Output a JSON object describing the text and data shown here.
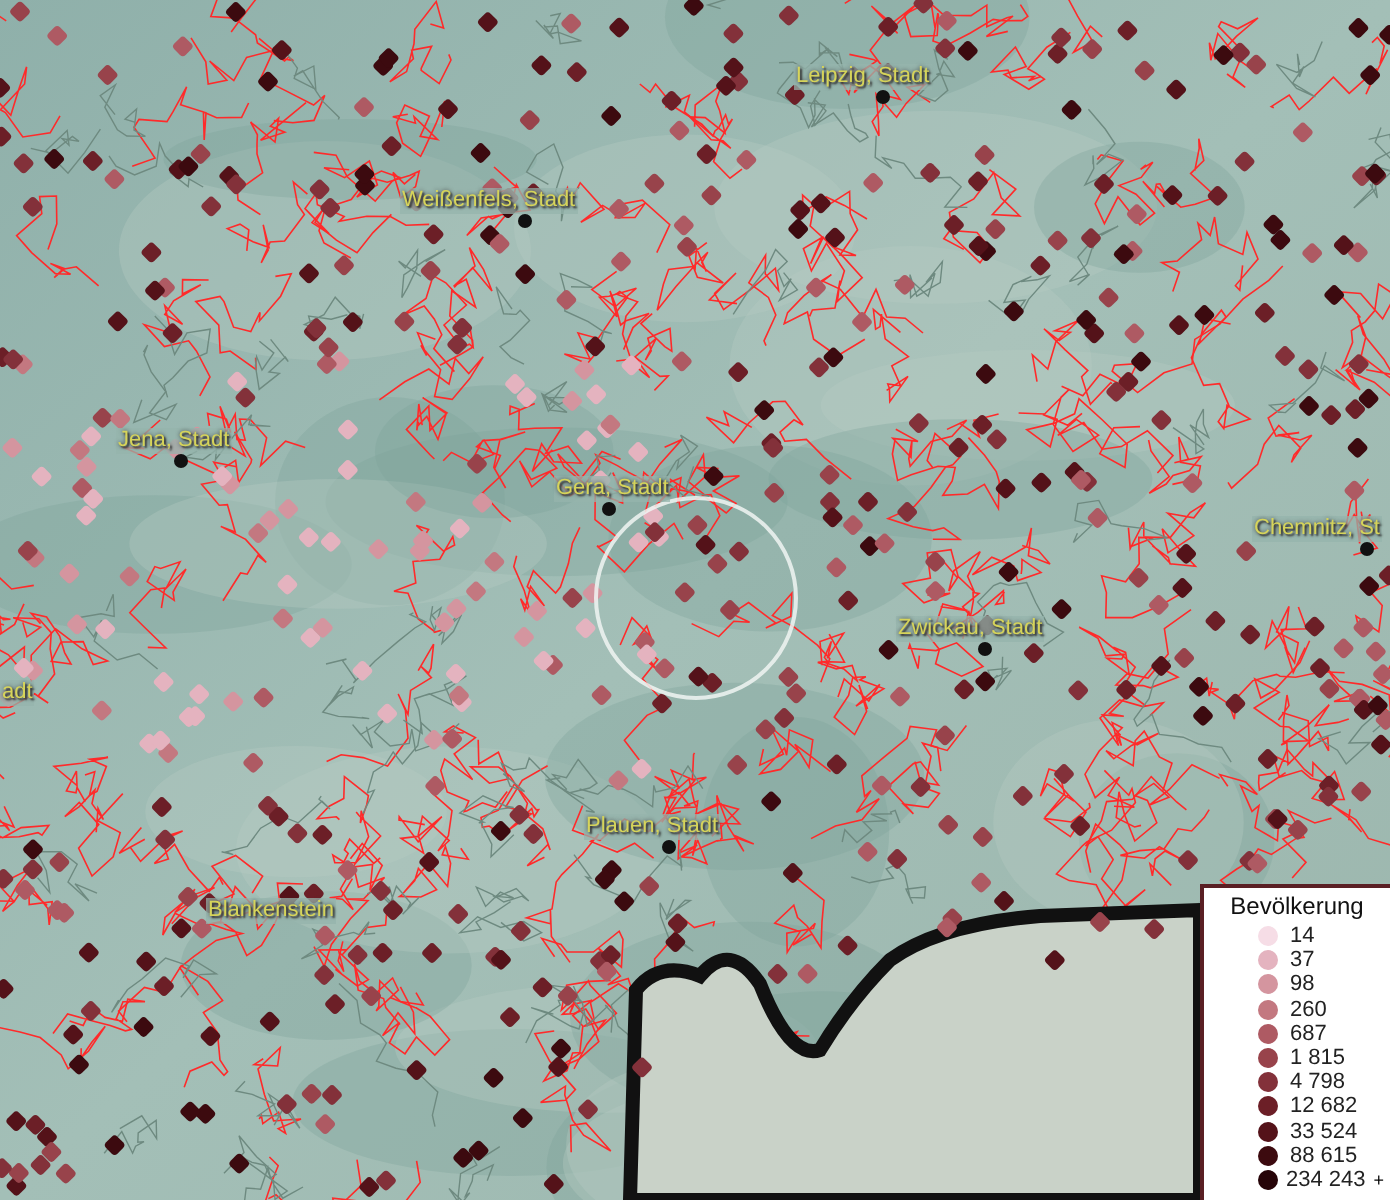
{
  "map": {
    "labels": [
      {
        "text": "Leipzig, Stadt",
        "has_dot": true
      },
      {
        "text": "Weißenfels, Stadt",
        "has_dot": true
      },
      {
        "text": "Jena, Stadt",
        "has_dot": true
      },
      {
        "text": "Gera, Stadt",
        "has_dot": true
      },
      {
        "text": "Chemnitz, St",
        "has_dot": true
      },
      {
        "text": "adt",
        "has_dot": false
      },
      {
        "text": "Zwickau, Stadt",
        "has_dot": true
      },
      {
        "text": "Plauen, Stadt",
        "has_dot": true
      },
      {
        "text": "Blankenstein",
        "has_dot": false
      }
    ]
  },
  "legend": {
    "title": "Bevölkerung",
    "overflow_mark": "+",
    "items": [
      {
        "value": "14",
        "color": "#f6dde6"
      },
      {
        "value": "37",
        "color": "#e4b3bf"
      },
      {
        "value": "98",
        "color": "#d4959f"
      },
      {
        "value": "260",
        "color": "#c37880"
      },
      {
        "value": "687",
        "color": "#ae5a63"
      },
      {
        "value": "1 815",
        "color": "#98434b"
      },
      {
        "value": "4 798",
        "color": "#83313a"
      },
      {
        "value": "12 682",
        "color": "#6c1f27"
      },
      {
        "value": "33 524",
        "color": "#541219"
      },
      {
        "value": "88 615",
        "color": "#3c0a0f"
      },
      {
        "value": "234 243",
        "color": "#260408"
      }
    ]
  }
}
